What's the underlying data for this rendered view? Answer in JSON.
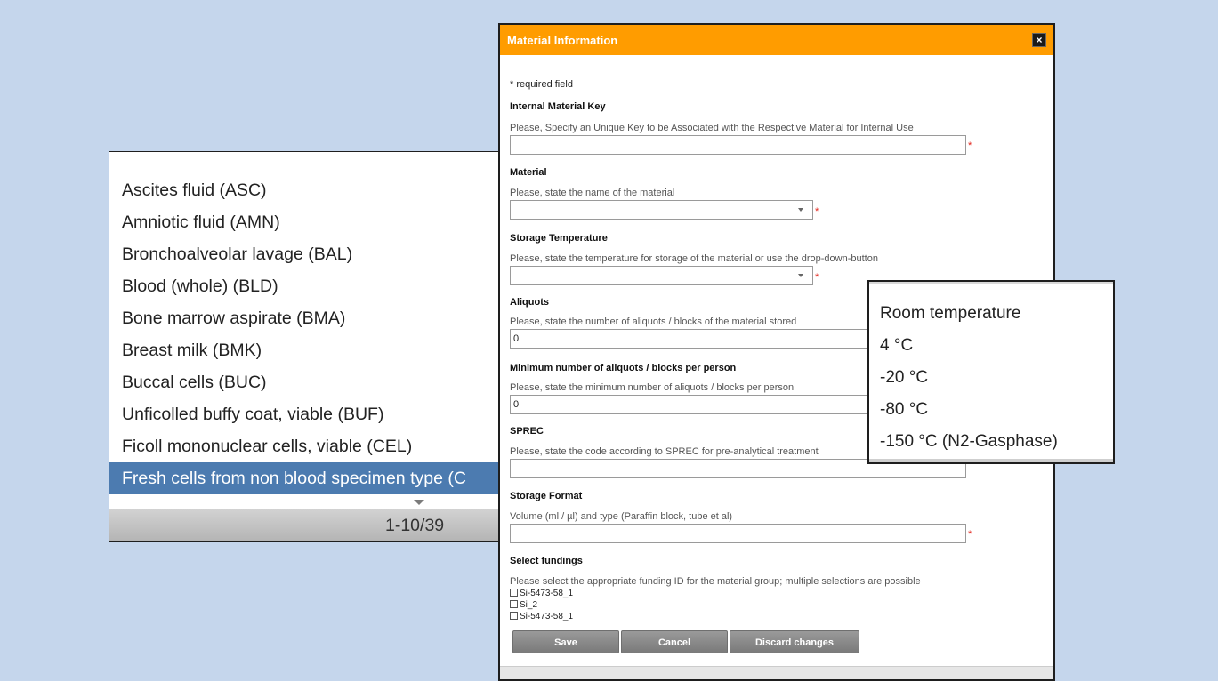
{
  "left_list": {
    "items": [
      "Ascites fluid (ASC)",
      "Amniotic fluid (AMN)",
      "Bronchoalveolar lavage (BAL)",
      "Blood (whole) (BLD)",
      "Bone marrow aspirate (BMA)",
      "Breast milk (BMK)",
      "Buccal cells (BUC)",
      "Unficolled buffy coat, viable (BUF)",
      "Ficoll mononuclear cells, viable (CEL)",
      "Fresh cells from non blood specimen type (C"
    ],
    "selected_index": 9,
    "pager": "1-10/39"
  },
  "dialog": {
    "title": "Material Information",
    "close_label": "×",
    "required_note": "* required field",
    "required_star": "*",
    "internal_key": {
      "label": "Internal Material Key",
      "hint": "Please, Specify an Unique Key to be Associated with the Respective Material for Internal Use",
      "value": ""
    },
    "material": {
      "label": "Material",
      "hint": "Please, state the name of the material",
      "value": ""
    },
    "storage_temperature": {
      "label": "Storage Temperature",
      "hint": "Please, state the temperature for storage of the material or use the drop-down-button",
      "value": ""
    },
    "aliquots": {
      "label": "Aliquots",
      "hint": "Please, state the number of aliquots / blocks of the material stored",
      "value": "0"
    },
    "min_aliquots": {
      "label": "Minimum number of aliquots / blocks per person",
      "hint": "Please, state the minimum number of aliquots / blocks per person",
      "value": "0"
    },
    "sprec": {
      "label": "SPREC",
      "hint": "Please, state the code according to SPREC for pre-analytical treatment",
      "value": ""
    },
    "storage_format": {
      "label": "Storage Format",
      "hint": "Volume (ml / µl) and type (Paraffin block, tube et al)",
      "value": ""
    },
    "fundings": {
      "label": "Select fundings",
      "hint": "Please select the appropriate funding ID for the material group; multiple selections are possible",
      "options": [
        "Si-5473-58_1",
        "Si_2",
        "Si-5473-58_1"
      ]
    },
    "buttons": {
      "save": "Save",
      "cancel": "Cancel",
      "discard": "Discard changes"
    }
  },
  "temperature_dropdown": {
    "options": [
      "Room temperature",
      "4 °C",
      "-20 °C",
      "-80 °C",
      "-150 °C (N2-Gasphase)"
    ]
  },
  "colors": {
    "background": "#c5d6ec",
    "header": "#ff9c00",
    "selection": "#4c7bb0",
    "required": "#e2231a"
  }
}
